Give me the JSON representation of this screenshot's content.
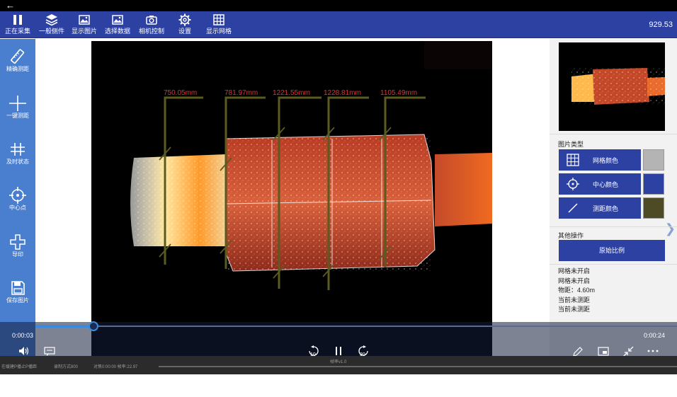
{
  "top": {
    "back_icon": "arrow-left-icon"
  },
  "toolbar": {
    "items": [
      {
        "label": "正在采集",
        "icon": "pause-icon"
      },
      {
        "label": "一般侧件",
        "icon": "layers-icon"
      },
      {
        "label": "显示图片",
        "icon": "image-icon"
      },
      {
        "label": "选择数据",
        "icon": "image-icon"
      },
      {
        "label": "相机控制",
        "icon": "camera-icon"
      },
      {
        "label": "设置",
        "icon": "gear-icon"
      },
      {
        "label": "显示网格",
        "icon": "grid-icon"
      }
    ],
    "value": "929.53"
  },
  "sidebar": {
    "items": [
      {
        "label": "精确测距",
        "icon": "ruler-icon"
      },
      {
        "label": "一键测距",
        "icon": "plus-line-icon"
      },
      {
        "label": "及时状态",
        "icon": "hash-icon"
      },
      {
        "label": "中心点",
        "icon": "crosshair-icon"
      },
      {
        "label": "导印",
        "icon": "arrow-plus-icon"
      },
      {
        "label": "保存图片",
        "icon": "save-icon"
      }
    ]
  },
  "measurements": [
    {
      "label": "750.05mm"
    },
    {
      "label": "781.97mm"
    },
    {
      "label": "1221.55mm"
    },
    {
      "label": "1228.81mm"
    },
    {
      "label": "1105.49mm"
    }
  ],
  "panel": {
    "image_type_title": "图片类型",
    "color_buttons": [
      {
        "label": "网格颜色",
        "icon": "grid-icon",
        "swatch": "#b4b4b4"
      },
      {
        "label": "中心颜色",
        "icon": "crosshair-icon",
        "swatch": "#2d41a3"
      },
      {
        "label": "测距颜色",
        "icon": "slash-icon",
        "swatch": "#4d4a26"
      }
    ],
    "other_ops_title": "其他操作",
    "original_ratio_button": "原始比例",
    "status_lines": [
      "网格未开启",
      "网格未开启",
      "物距：4.60m",
      "当前未测距",
      "当前未测距"
    ]
  },
  "player": {
    "time_current": "0:00:03",
    "time_total": "0:00:24",
    "progress": 0.09,
    "rewind_label": "10",
    "forward_label": "30"
  },
  "taskbar": {
    "segments": [
      "在缓建P播止P播距",
      "录制方式800",
      "对焦0:00:00 帧率:22.97",
      "帧率v1.0"
    ]
  },
  "colors": {
    "toolbar": "#2d41a3",
    "sidebar": "#4a7fd0",
    "measure_label": "#d8363a",
    "measure_line": "#5b5a20"
  }
}
